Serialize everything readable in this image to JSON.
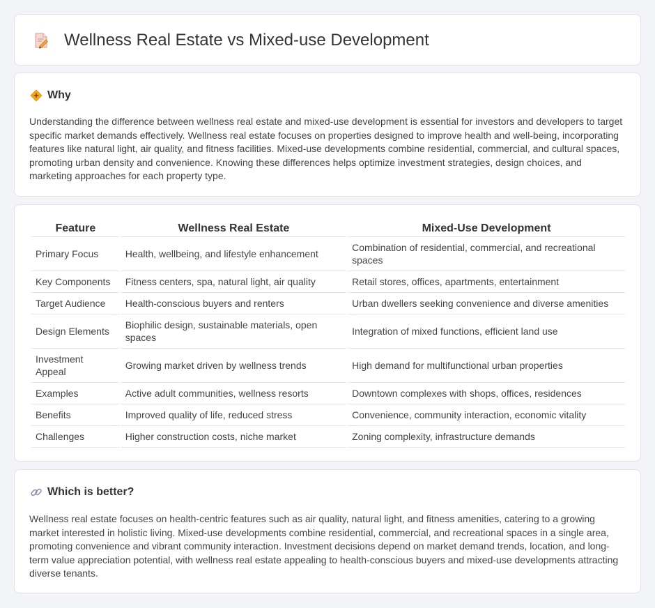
{
  "header": {
    "title": "Wellness Real Estate vs Mixed-use Development",
    "icon": "document-pencil-icon"
  },
  "why": {
    "heading": "Why",
    "icon": "diamond-icon",
    "text": "Understanding the difference between wellness real estate and mixed-use development is essential for investors and developers to target specific market demands effectively. Wellness real estate focuses on properties designed to improve health and well-being, incorporating features like natural light, air quality, and fitness facilities. Mixed-use developments combine residential, commercial, and cultural spaces, promoting urban density and convenience. Knowing these differences helps optimize investment strategies, design choices, and marketing approaches for each property type."
  },
  "table": {
    "headers": [
      "Feature",
      "Wellness Real Estate",
      "Mixed-Use Development"
    ],
    "rows": [
      [
        "Primary Focus",
        "Health, wellbeing, and lifestyle enhancement",
        "Combination of residential, commercial, and recreational spaces"
      ],
      [
        "Key Components",
        "Fitness centers, spa, natural light, air quality",
        "Retail stores, offices, apartments, entertainment"
      ],
      [
        "Target Audience",
        "Health-conscious buyers and renters",
        "Urban dwellers seeking convenience and diverse amenities"
      ],
      [
        "Design Elements",
        "Biophilic design, sustainable materials, open spaces",
        "Integration of mixed functions, efficient land use"
      ],
      [
        "Investment Appeal",
        "Growing market driven by wellness trends",
        "High demand for multifunctional urban properties"
      ],
      [
        "Examples",
        "Active adult communities, wellness resorts",
        "Downtown complexes with shops, offices, residences"
      ],
      [
        "Benefits",
        "Improved quality of life, reduced stress",
        "Convenience, community interaction, economic vitality"
      ],
      [
        "Challenges",
        "Higher construction costs, niche market",
        "Zoning complexity, infrastructure demands"
      ]
    ]
  },
  "better": {
    "heading": "Which is better?",
    "icon": "link-icon",
    "text": "Wellness real estate focuses on health-centric features such as air quality, natural light, and fitness amenities, catering to a growing market interested in holistic living. Mixed-use developments combine residential, commercial, and recreational spaces in a single area, promoting convenience and vibrant community interaction. Investment decisions depend on market demand trends, location, and long-term value appreciation potential, with wellness real estate appealing to health-conscious buyers and mixed-use developments attracting diverse tenants."
  }
}
